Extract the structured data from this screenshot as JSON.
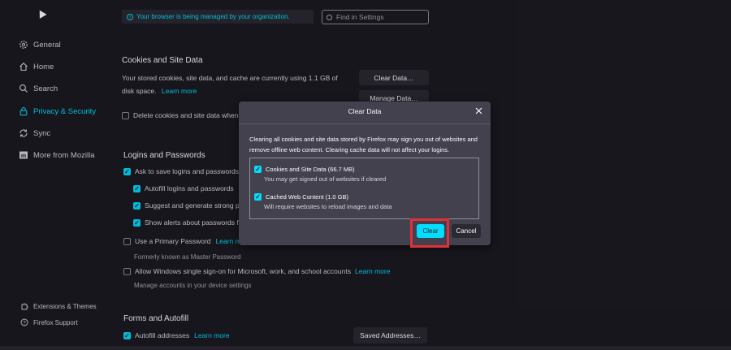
{
  "top": {
    "managed_text": "Your browser is being managed by your organization.",
    "find_placeholder": "Find in Settings"
  },
  "sidebar": {
    "items": [
      {
        "label": "General",
        "icon": "gear-icon"
      },
      {
        "label": "Home",
        "icon": "home-icon"
      },
      {
        "label": "Search",
        "icon": "search-icon"
      },
      {
        "label": "Privacy & Security",
        "icon": "lock-icon",
        "active": true
      },
      {
        "label": "Sync",
        "icon": "sync-icon"
      },
      {
        "label": "More from Mozilla",
        "icon": "mozilla-icon"
      }
    ],
    "footer": [
      {
        "label": "Extensions & Themes",
        "icon": "puzzle-icon"
      },
      {
        "label": "Firefox Support",
        "icon": "help-icon"
      }
    ]
  },
  "cookies": {
    "heading": "Cookies and Site Data",
    "desc_line1": "Your stored cookies, site data, and cache are currently using 1.1 GB of",
    "desc_line2": "disk space.",
    "learn_more": "Learn more",
    "clear_data_btn": "Clear Data…",
    "manage_data_btn": "Manage Data…",
    "delete_on_close": "Delete cookies and site data when"
  },
  "logins": {
    "heading": "Logins and Passwords",
    "ask_save": "Ask to save logins and passwords f",
    "autofill": "Autofill logins and passwords",
    "suggest": "Suggest and generate strong p",
    "alerts": "Show alerts about passwords f",
    "primary_pw": "Use a Primary Password",
    "primary_learn": "Learn mor",
    "formerly": "Formerly known as Master Password",
    "sso": "Allow Windows single sign-on for Microsoft, work, and school accounts",
    "sso_learn": "Learn more",
    "manage_accounts": "Manage accounts in your device settings"
  },
  "forms": {
    "heading": "Forms and Autofill",
    "autofill_addresses": "Autofill addresses",
    "learn_more": "Learn more",
    "saved_addresses_btn": "Saved Addresses…"
  },
  "dialog": {
    "title": "Clear Data",
    "description_line1": "Clearing all cookies and site data stored by Firefox may sign you out of websites and",
    "description_line2": "remove offline web content. Clearing cache data will not affect your logins.",
    "option1_label": "Cookies and Site Data (66.7 MB)",
    "option1_desc": "You may get signed out of websites if cleared",
    "option2_label": "Cached Web Content (1.0 GB)",
    "option2_desc": "Will require websites to reload images and data",
    "clear_btn": "Clear",
    "cancel_btn": "Cancel"
  },
  "colors": {
    "accent": "#00ddff",
    "highlight": "#e0313a",
    "background": "#1c1b22",
    "dialog": "#42414d"
  }
}
